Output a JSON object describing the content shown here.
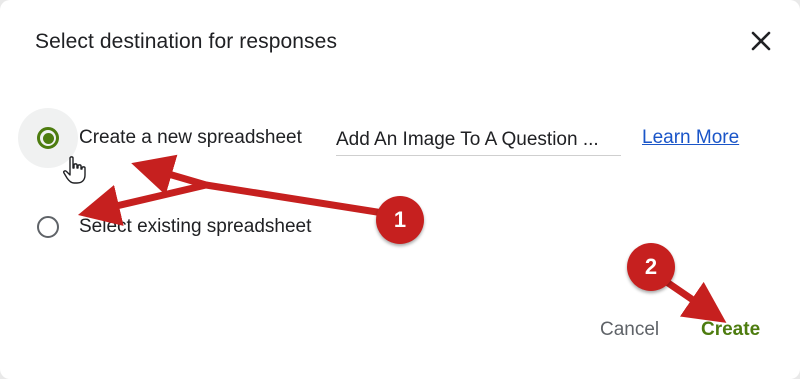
{
  "dialog": {
    "title": "Select destination for responses",
    "close_icon": "close-icon"
  },
  "options": [
    {
      "label": "Create a new spreadsheet",
      "checked": true
    },
    {
      "label": "Select existing spreadsheet",
      "checked": false
    }
  ],
  "spreadsheet_name": {
    "value": "Add An Image To A Question ..."
  },
  "learn_more": {
    "label": "Learn More"
  },
  "actions": {
    "cancel_label": "Cancel",
    "create_label": "Create"
  },
  "annotations": {
    "badge1": "1",
    "badge2": "2",
    "color": "#c6201f"
  },
  "colors": {
    "accent": "#4d7c0f",
    "link": "#1a55c8"
  }
}
